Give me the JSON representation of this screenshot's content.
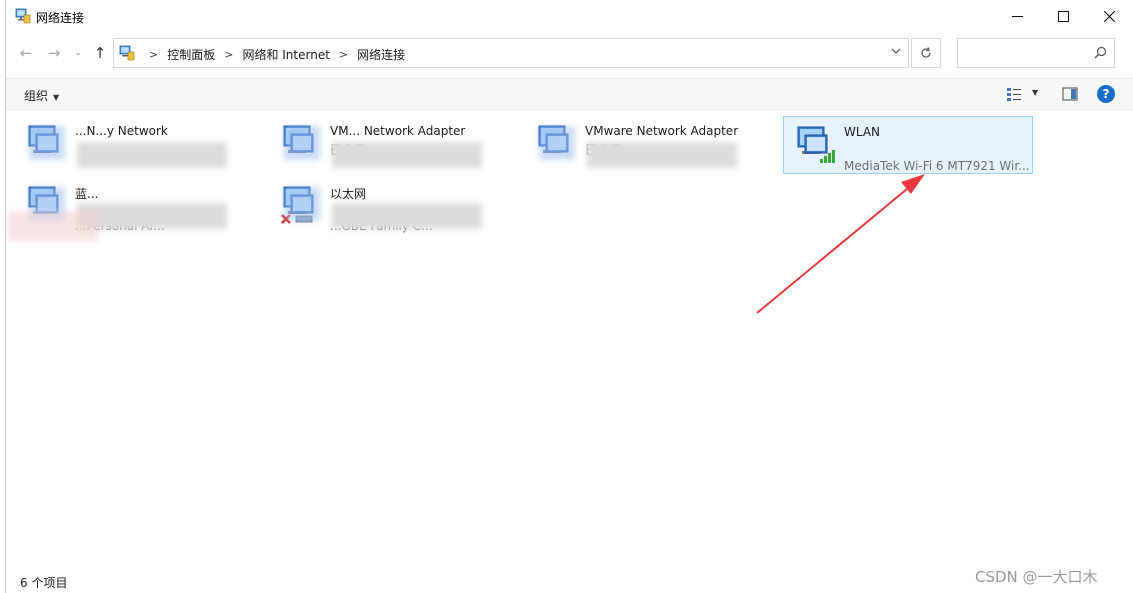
{
  "window": {
    "title": "网络连接",
    "icon": "network-connections-icon"
  },
  "controls": {
    "minimize": "minimize-icon",
    "maximize": "maximize-icon",
    "close": "close-icon"
  },
  "nav": {
    "back": "←",
    "forward": "→",
    "recent": "⌄",
    "up": "↑"
  },
  "breadcrumb": [
    "控制面板",
    "网络和 Internet",
    "网络连接"
  ],
  "search": {
    "placeholder": ""
  },
  "toolbar": {
    "organize": "组织",
    "help": "?"
  },
  "items": [
    {
      "name": "...N...y Network",
      "status": "",
      "device": "",
      "icon": "network-adapter-icon",
      "redacted": true
    },
    {
      "name": "VM... Network Adapter",
      "status": "已启用",
      "device": "",
      "icon": "network-adapter-icon",
      "redacted": true
    },
    {
      "name": "VMware Network Adapter",
      "status": "已启用",
      "device": "",
      "icon": "network-adapter-icon",
      "redacted": true
    },
    {
      "name": "WLAN",
      "status": "",
      "device": "MediaTek Wi-Fi 6 MT7921 Wir...",
      "icon": "wifi-adapter-icon",
      "selected": true
    },
    {
      "name": "蓝...",
      "status": "",
      "device": "...Personal Ar...",
      "icon": "bluetooth-adapter-icon",
      "redacted": true
    },
    {
      "name": "以太网",
      "status": "",
      "device": "...GBE Family C...",
      "icon": "ethernet-adapter-disconnected-icon",
      "redacted": true
    }
  ],
  "statusbar": {
    "count": "6 个项目"
  },
  "watermark": "CSDN @一大口木",
  "colors": {
    "accent": "#1a6fc9",
    "selection_border": "#99d1ff",
    "selection_fill": "#e5f3ff",
    "annotation_arrow": "#e8383d"
  }
}
